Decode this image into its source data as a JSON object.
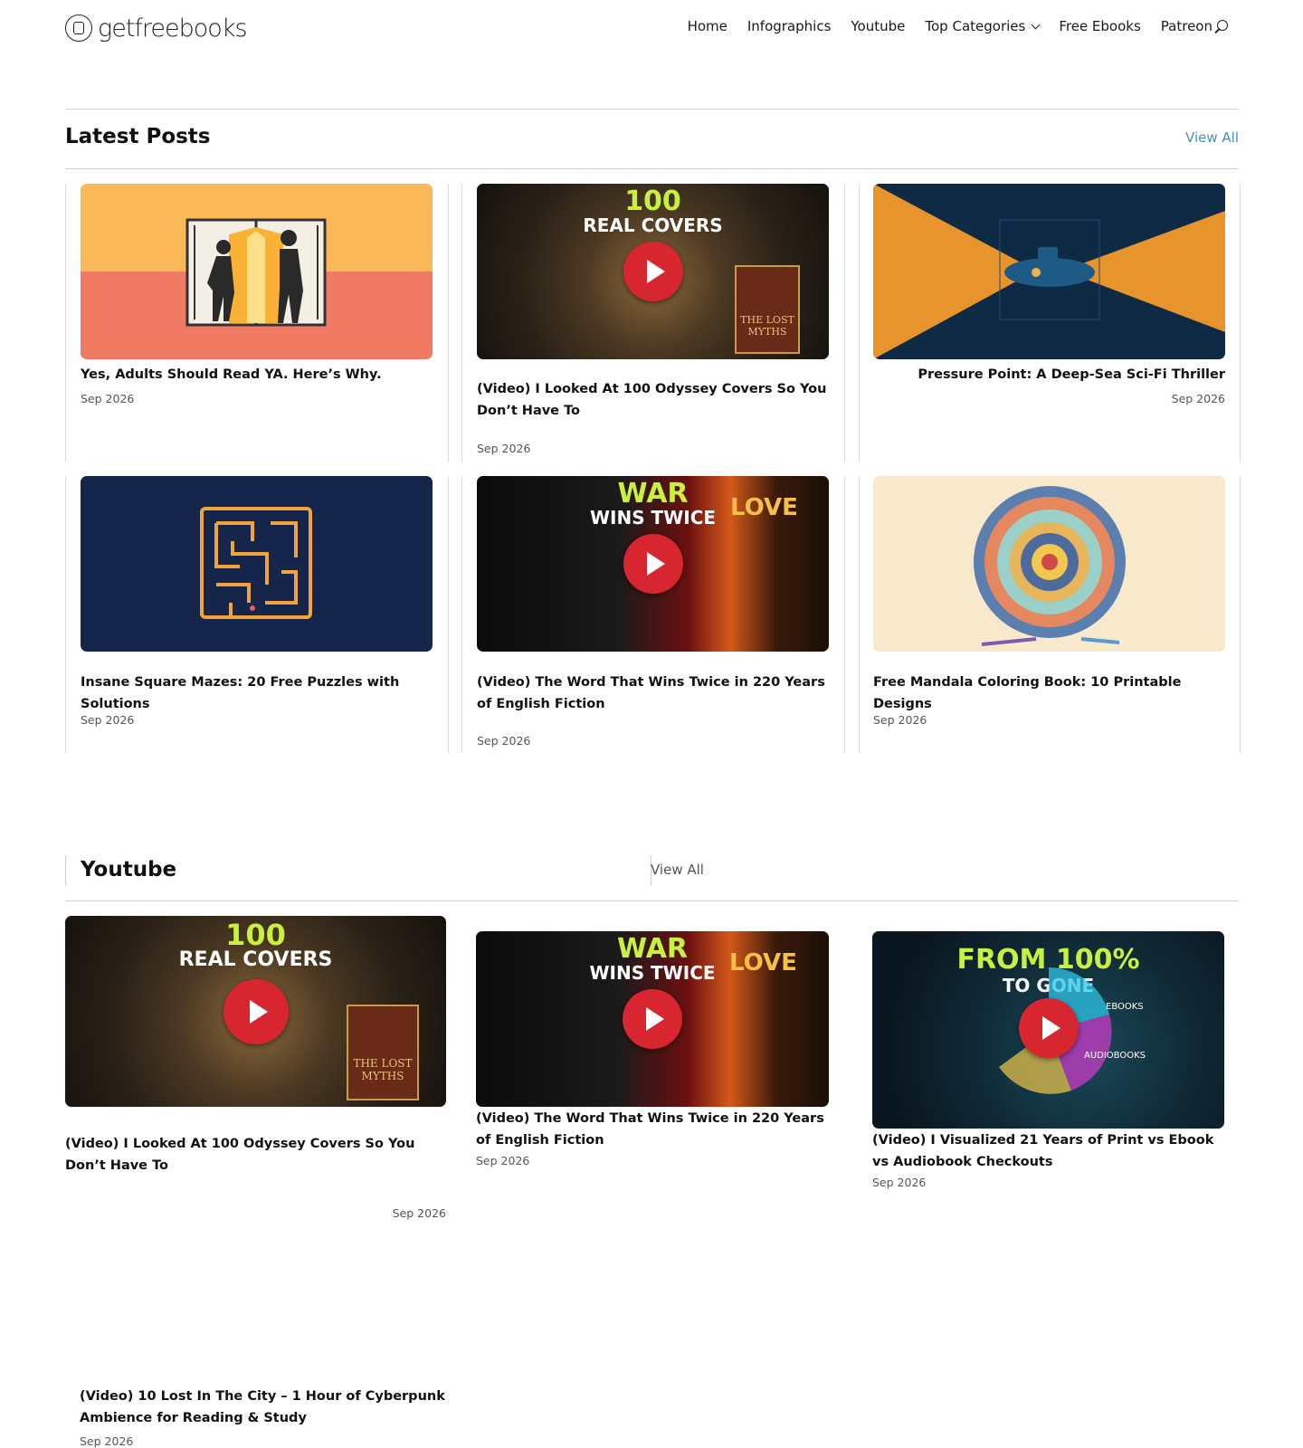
{
  "brand": {
    "logo_text": "getfreebooks"
  },
  "nav": {
    "items": [
      "Home",
      "Infographics",
      "Youtube",
      "Top Categories",
      "Free Ebooks",
      "Patreon"
    ]
  },
  "latest": {
    "title": "Latest Posts",
    "view_all": "View All",
    "posts": [
      {
        "title": "Yes, Adults Should Read YA. Here’s Why.",
        "date": "Sep 2026"
      },
      {
        "title": "(Video) I Looked At 100 Odyssey Covers So You Don’t Have To",
        "date": "Sep 2026",
        "overlay_top": "100",
        "overlay_bottom": "REAL COVERS",
        "book_title": "THE LOST MYTHS"
      },
      {
        "title": "Pressure Point: A Deep-Sea Sci-Fi Thriller",
        "date": "Sep 2026"
      },
      {
        "title": "Insane Square Mazes: 20 Free Puzzles with Solutions",
        "date": "Sep 2026"
      },
      {
        "title": "(Video) The Word That Wins Twice in 220 Years of English Fiction",
        "date": "Sep 2026",
        "overlay_top": "WAR",
        "overlay_bottom": "WINS TWICE",
        "side_word": "LOVE"
      },
      {
        "title": "Free Mandala Coloring Book: 10 Printable Designs",
        "date": "Sep 2026"
      }
    ]
  },
  "youtube": {
    "title": "Youtube",
    "view_all": "View All",
    "videos": [
      {
        "title": "(Video) I Looked At 100 Odyssey Covers So You Don’t Have To",
        "date": "Sep 2026",
        "overlay_top": "100",
        "overlay_bottom": "REAL COVERS",
        "book_title": "THE LOST MYTHS"
      },
      {
        "title": "(Video) The Word That Wins Twice in 220 Years of English Fiction",
        "date": "Sep 2026",
        "overlay_top": "WAR",
        "overlay_bottom": "WINS TWICE",
        "side_word": "LOVE"
      },
      {
        "title": "(Video) I Visualized 21 Years of Print vs Ebook vs Audiobook Checkouts",
        "date": "Sep 2026",
        "overlay_top": "FROM 100%",
        "overlay_bottom": "TO GONE",
        "label_a": "EBOOKS",
        "label_b": "AUDIOBOOKS"
      },
      {
        "title": "(Video) 10 Lost In The City – 1 Hour of Cyberpunk Ambience for Reading & Study",
        "date": "Sep 2026"
      }
    ]
  },
  "colors": {
    "accent_link": "#4a90c2",
    "play_button": "#d7262f"
  }
}
